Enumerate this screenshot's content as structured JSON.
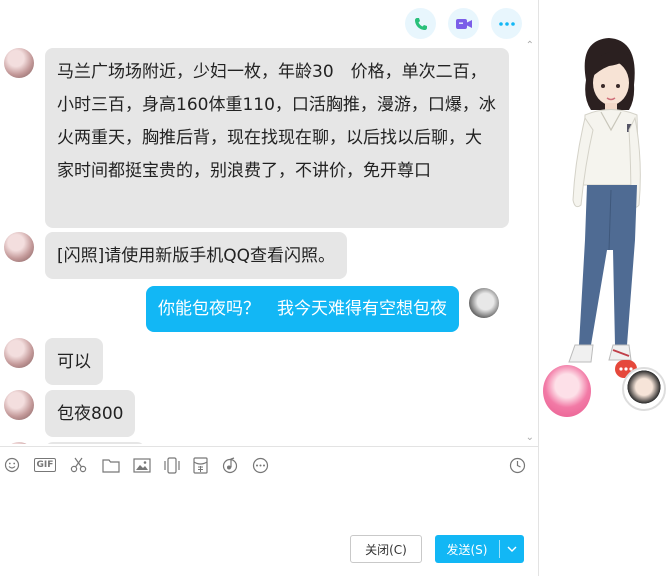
{
  "header": {
    "actions": [
      {
        "name": "voice-call",
        "icon": "phone-icon",
        "color": "#29c07a"
      },
      {
        "name": "video-call",
        "icon": "video-icon",
        "color": "#7b5ee8"
      },
      {
        "name": "more",
        "icon": "more-dots-icon",
        "color": "#12b7f5"
      }
    ]
  },
  "messages": [
    {
      "side": "left",
      "text": "马兰广场场附近，少妇一枚，年龄30　价格，单次二百，小时三百，身高160体重110，口活胸推，漫游，口爆，冰火两重天，胸推后背，现在找现在聊，以后找以后聊，大家时间都挺宝贵的，别浪费了，不讲价，免开尊口"
    },
    {
      "side": "left",
      "text": "[闪照]请使用新版手机QQ查看闪照。"
    },
    {
      "side": "right",
      "text": "你能包夜吗？　我今天难得有空想包夜"
    },
    {
      "side": "left",
      "text": "可以"
    },
    {
      "side": "left",
      "text": "包夜800"
    }
  ],
  "toolbar": {
    "tools": [
      "emoji-icon",
      "gif-icon",
      "scissors-icon",
      "folder-icon",
      "image-icon",
      "shake-icon",
      "red-packet-icon",
      "music-icon",
      "more-icon",
      "history-clock-icon"
    ],
    "gif_label": "GIF"
  },
  "footer": {
    "close_label": "关闭(C)",
    "send_label": "发送(S)"
  },
  "colors": {
    "accent": "#12b7f5",
    "bubble_gray": "#e6e6e6"
  }
}
